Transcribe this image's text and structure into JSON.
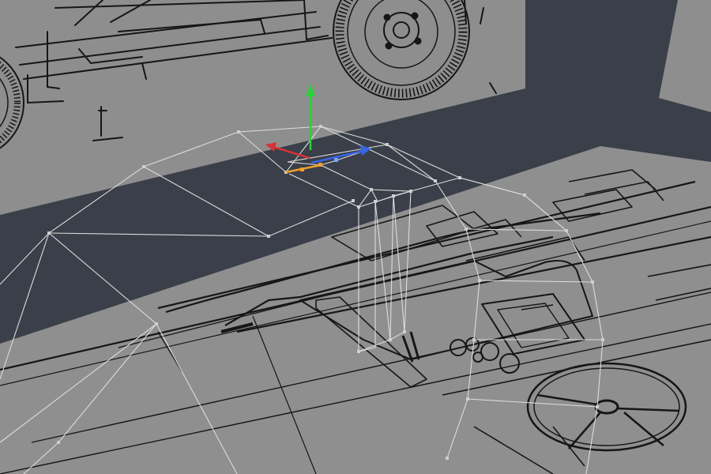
{
  "viewport": {
    "view": "3d-perspective",
    "colors": {
      "side_panel": "#8e8e8e",
      "floor_panel": "#8f8f8f",
      "backdrop": "#3a3f49",
      "blueprint_line": "#161616",
      "wireframe_edge": "#dcdcdc",
      "vertex": "#cfcfcf",
      "axis_x": "#d63434",
      "axis_y": "#2bd13a",
      "axis_z": "#3a64e4",
      "selected_edge": "#f0a028"
    },
    "icons": [
      "move-gizmo-icon",
      "axis-x-handle-icon",
      "axis-y-handle-icon",
      "axis-z-handle-icon"
    ]
  }
}
